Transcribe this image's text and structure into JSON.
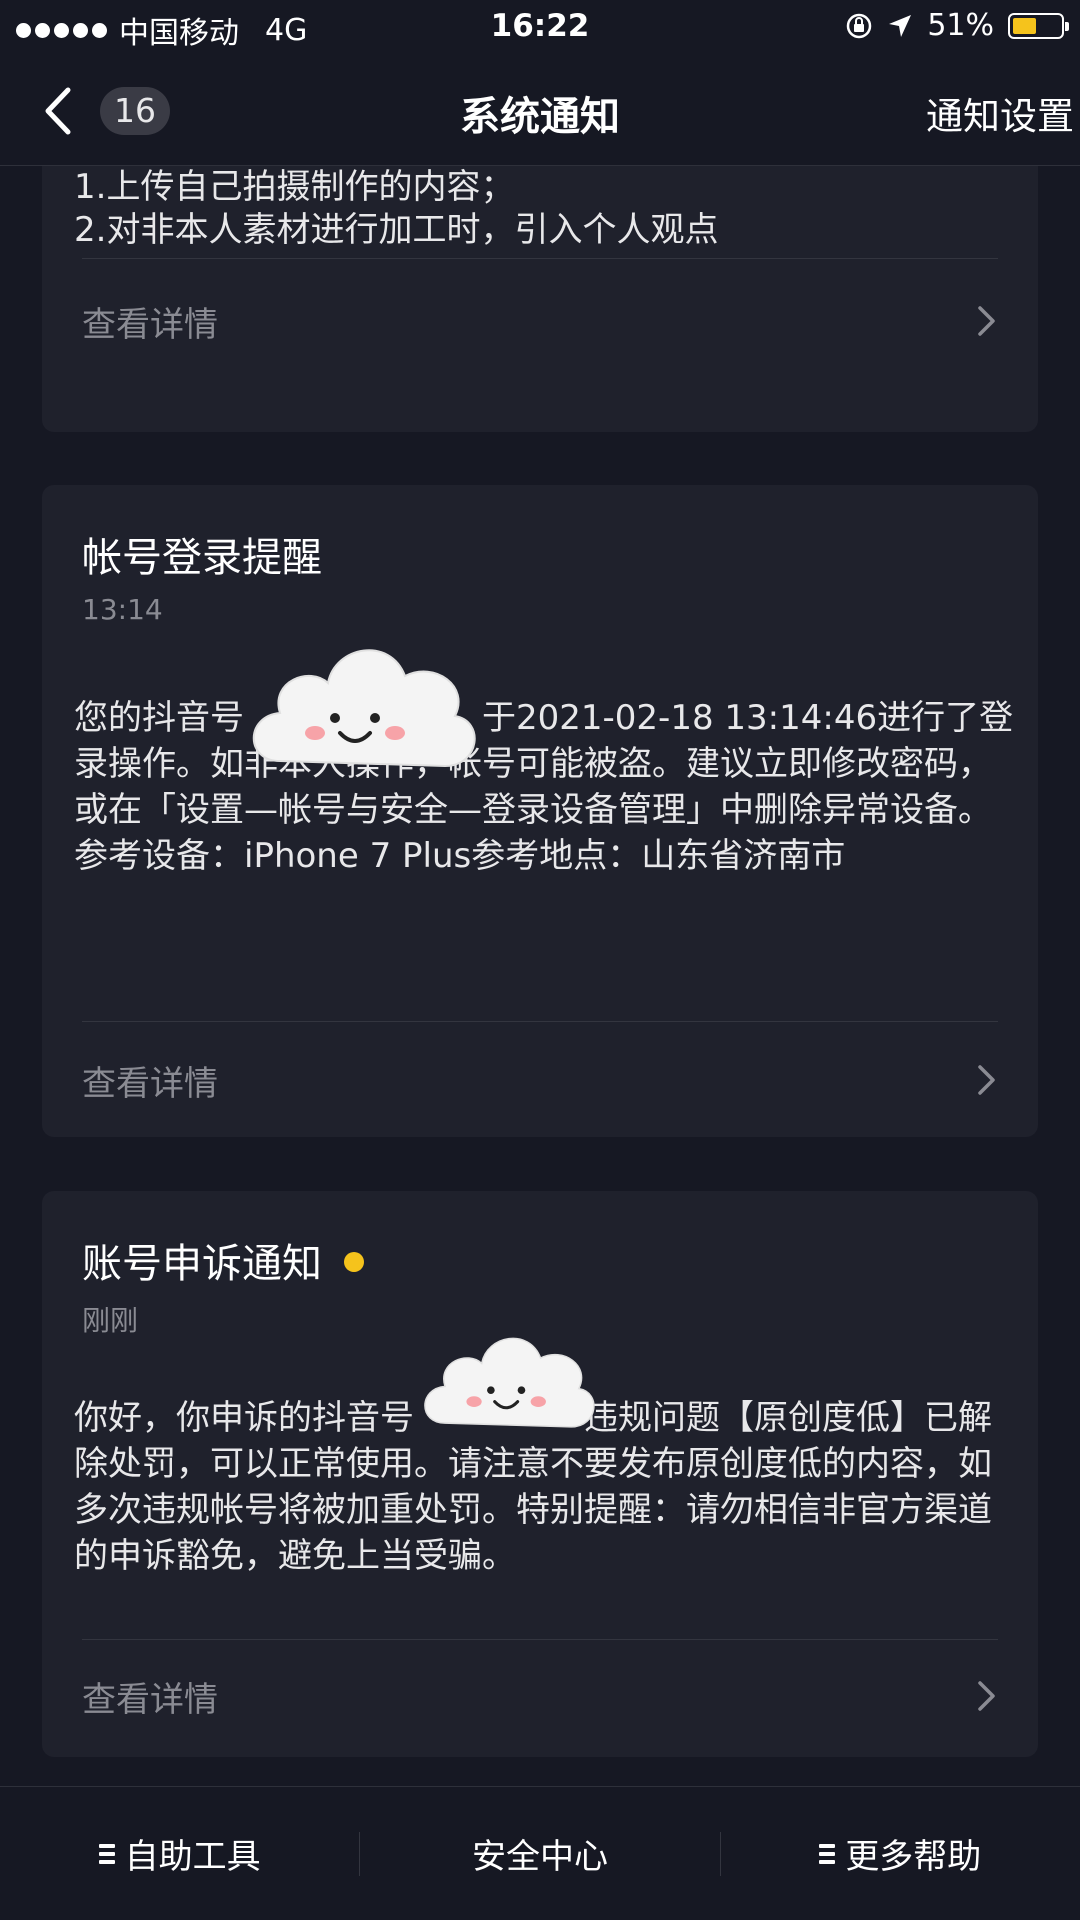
{
  "status_bar": {
    "carrier": "中国移动",
    "network": "4G",
    "time": "16:22",
    "battery_percent": "51%",
    "battery_level": 0.51,
    "battery_color": "#f5c31c"
  },
  "nav": {
    "back_icon": "chevron-left-icon",
    "unread_count": "16",
    "title": "系统通知",
    "settings_label": "通知设置"
  },
  "notifications": [
    {
      "body_lines": [
        "1.上传自己拍摄制作的内容；",
        "2.对非本人素材进行加工时，引入个人观点"
      ],
      "detail_label": "查看详情"
    },
    {
      "title": "帐号登录提醒",
      "time": "13:14",
      "body": "您的抖音号　　　　　　　于2021-02-18 13:14:46进行了登录操作。如非本人操作，帐号可能被盗。建议立即修改密码，或在「设置—帐号与安全—登录设备管理」中删除异常设备。参考设备：iPhone 7 Plus参考地点：山东省济南市",
      "detail_label": "查看详情"
    },
    {
      "title": "账号申诉通知",
      "unread": true,
      "time": "刚刚",
      "body": "你好，你申诉的抖音号　　　　　违规问题【原创度低】已解除处罚，可以正常使用。请注意不要发布原创度低的内容，如多次违规帐号将被加重处罚。特别提醒：请勿相信非官方渠道的申诉豁免，避免上当受骗。",
      "detail_label": "查看详情"
    }
  ],
  "bottom_bar": {
    "self_help": "自助工具",
    "security": "安全中心",
    "more_help": "更多帮助"
  }
}
